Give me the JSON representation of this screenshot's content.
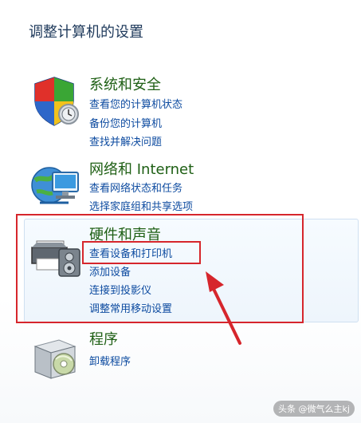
{
  "page": {
    "title": "调整计算机的设置"
  },
  "categories": [
    {
      "title": "系统和安全",
      "icon": "shield-icon",
      "links": [
        "查看您的计算机状态",
        "备份您的计算机",
        "查找并解决问题"
      ]
    },
    {
      "title": "网络和 Internet",
      "icon": "network-globe-icon",
      "links": [
        "查看网络状态和任务",
        "选择家庭组和共享选项"
      ]
    },
    {
      "title": "硬件和声音",
      "icon": "printer-speaker-icon",
      "links": [
        "查看设备和打印机",
        "添加设备",
        "连接到投影仪",
        "调整常用移动设置"
      ]
    },
    {
      "title": "程序",
      "icon": "programs-box-icon",
      "links": [
        "卸载程序"
      ]
    }
  ],
  "annotation": {
    "color": "#d6262c"
  },
  "watermark": "头条 @微气么主kj"
}
